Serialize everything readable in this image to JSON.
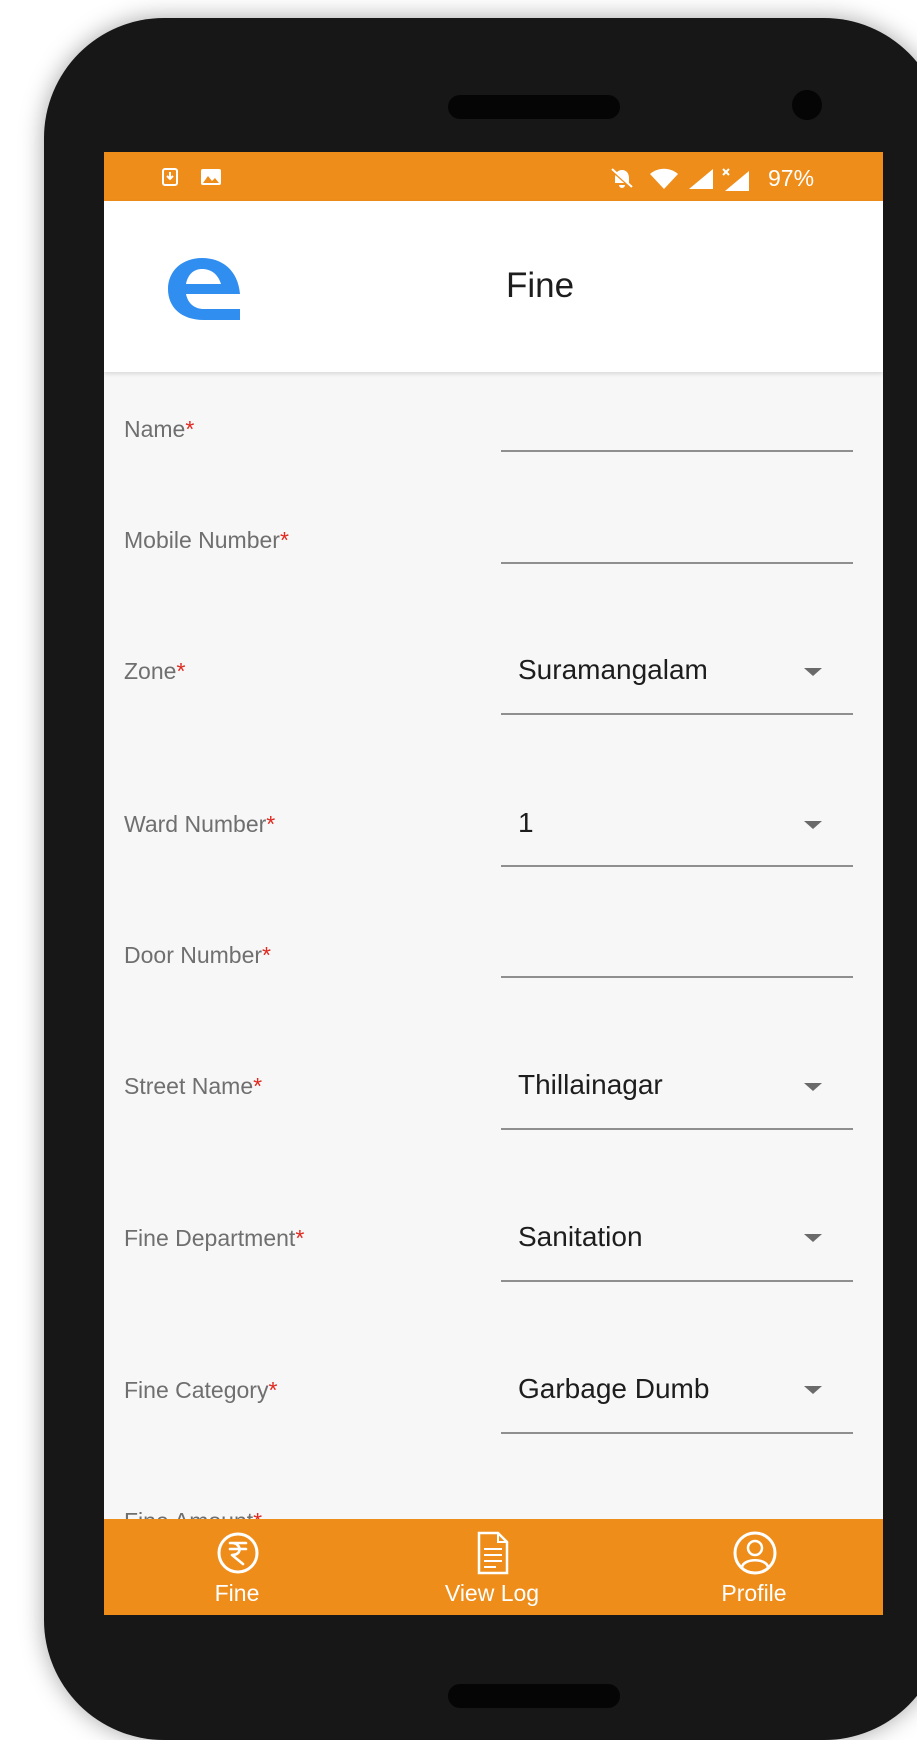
{
  "status_bar": {
    "battery": "97%",
    "icons": [
      "sim-download-icon",
      "image-icon",
      "mute-bell-icon",
      "wifi-icon",
      "signal-icon",
      "signal-x-icon"
    ]
  },
  "app_bar": {
    "title": "Fine",
    "logo": "e-logo"
  },
  "form": {
    "fields": [
      {
        "label": "Name",
        "required": "*",
        "value": ""
      },
      {
        "label": "Mobile Number",
        "required": "*",
        "value": ""
      },
      {
        "label": "Zone",
        "required": "*",
        "value": "Suramangalam"
      },
      {
        "label": "Ward Number",
        "required": "*",
        "value": "1"
      },
      {
        "label": "Door Number",
        "required": "*",
        "value": ""
      },
      {
        "label": "Street Name",
        "required": "*",
        "value": "Thillainagar"
      },
      {
        "label": "Fine Department",
        "required": "*",
        "value": "Sanitation"
      },
      {
        "label": "Fine Category",
        "required": "*",
        "value": "Garbage Dumb"
      },
      {
        "label": "Fine Amount",
        "required": "*",
        "value": ""
      }
    ]
  },
  "bottom_nav": {
    "items": [
      {
        "label": "Fine",
        "icon": "rupee-icon"
      },
      {
        "label": "View Log",
        "icon": "document-icon"
      },
      {
        "label": "Profile",
        "icon": "profile-icon"
      }
    ]
  },
  "colors": {
    "accent": "#ef8d1a",
    "logo_blue": "#2f8ef0",
    "required": "#e0291f"
  }
}
